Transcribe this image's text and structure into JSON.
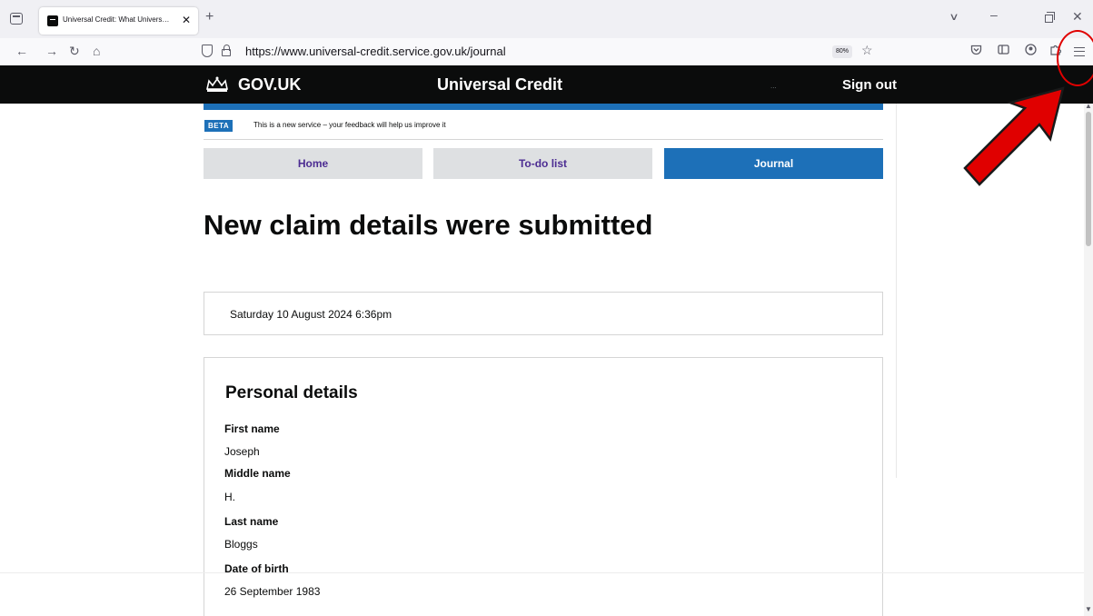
{
  "browser": {
    "tab_title": "Universal Credit: What Univers…",
    "tab_close": "✕",
    "new_tab": "+",
    "url": "https://www.universal-credit.service.gov.uk/journal",
    "zoom": "80%",
    "icons": [
      "tab-list-icon",
      "back-arrow-icon",
      "forward-arrow-icon",
      "reload-icon",
      "home-icon",
      "shield-icon",
      "lock-icon",
      "bookmark-star-icon",
      "pocket-icon",
      "sidebar-icon",
      "account-icon",
      "extensions-icon",
      "menu-icon",
      "minimize-icon",
      "restore-icon",
      "close-icon"
    ],
    "nav": {
      "back": "←",
      "forward": "→",
      "reload": "↻",
      "home": "⌂"
    },
    "star": "☆",
    "window": {
      "minimize": "–",
      "close": "✕",
      "list_tabs": "∨"
    }
  },
  "header": {
    "logo": "GOV.UK",
    "service_name": "Universal Credit",
    "user_name": "...",
    "sign_out": "Sign out",
    "header_color": "#0b0c0c",
    "accent_color": "#1d70b8"
  },
  "phase_banner": {
    "tag": "BETA",
    "text": "This is a new service – your feedback will help us improve it"
  },
  "nav_tabs": [
    {
      "label": "Home",
      "active": false
    },
    {
      "label": "To-do list",
      "active": false
    },
    {
      "label": "Journal",
      "active": true
    }
  ],
  "page": {
    "title": "New claim details were submitted",
    "timestamp": "Saturday 10 August 2024 6:36pm"
  },
  "personal_details": {
    "heading": "Personal details",
    "fields": [
      {
        "label": "First name",
        "value": "Joseph"
      },
      {
        "label": "Middle name",
        "value": "H."
      },
      {
        "label": "Last name",
        "value": "Bloggs"
      },
      {
        "label": "Date of birth",
        "value": "26 September 1983"
      }
    ]
  },
  "annotation": {
    "color": "#e00000"
  }
}
